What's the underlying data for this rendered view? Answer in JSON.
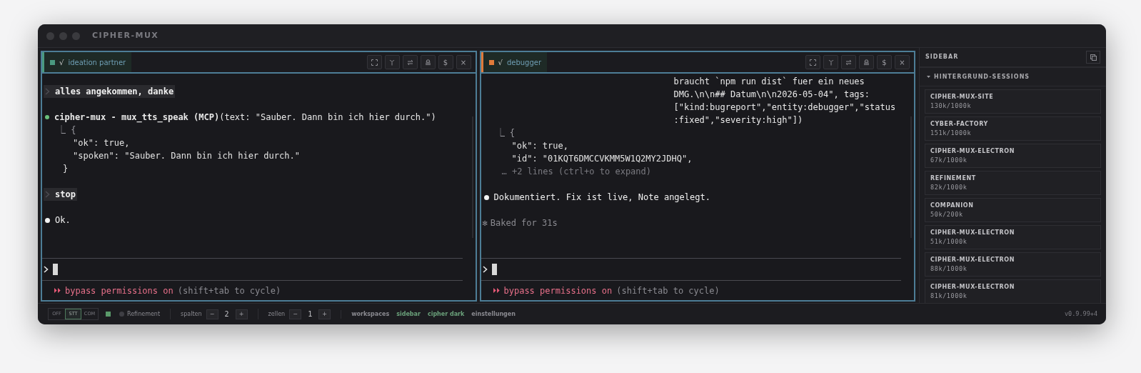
{
  "window": {
    "title": "CIPHER-MUX"
  },
  "panes": [
    {
      "title": "ideation partner",
      "check": "√",
      "color": "#4a9a80",
      "buttons": [
        {
          "kind": "maximize"
        },
        {
          "kind": "pin"
        },
        {
          "kind": "swap"
        },
        {
          "kind": "stack"
        },
        {
          "kind": "text",
          "label": "$"
        },
        {
          "kind": "text",
          "label": "×"
        }
      ],
      "messages": [
        {
          "kind": "user",
          "text": "alles angekommen, danke"
        },
        {
          "kind": "tool",
          "text": "**cipher-mux - mux_tts_speak (MCP)**(text: \"Sauber. Dann bin ich hier durch.\")",
          "output": {
            "head": "⎿ {",
            "lines": [
              "\"ok\": true,",
              "\"spoken\": \"Sauber. Dann bin ich hier durch.\""
            ],
            "tail": "}"
          }
        },
        {
          "kind": "user",
          "text": "stop"
        },
        {
          "kind": "assistant",
          "text": "Ok."
        }
      ],
      "mode": {
        "marker": "⏵⏵",
        "label": "bypass permissions on",
        "hint": "(shift+tab to cycle)"
      }
    },
    {
      "title": "debugger",
      "check": "√",
      "color": "#e07a3a",
      "buttons": [
        {
          "kind": "maximize"
        },
        {
          "kind": "pin"
        },
        {
          "kind": "swap"
        },
        {
          "kind": "stack"
        },
        {
          "kind": "text",
          "label": "$"
        },
        {
          "kind": "text",
          "label": "×"
        }
      ],
      "messages": [
        {
          "kind": "continuation",
          "lines": [
            "braucht `npm run dist` fuer ein neues",
            "DMG.\\n\\n## Datum\\n\\n2026-05-04\", tags:",
            "[\"kind:bugreport\",\"entity:debugger\",\"status",
            ":fixed\",\"severity:high\"])"
          ],
          "output": {
            "head": "⎿ {",
            "lines": [
              "\"ok\": true,",
              "\"id\": \"01KQT6DMCCVKMM5W1Q2MY2JDHQ\","
            ],
            "note": "… +2 lines (ctrl+o to expand)"
          }
        },
        {
          "kind": "assistant",
          "text": "Dokumentiert. Fix ist live, Note angelegt."
        },
        {
          "kind": "status",
          "marker": "✻",
          "text": "Baked for 31s"
        }
      ],
      "mode": {
        "marker": "⏵⏵",
        "label": "bypass permissions on",
        "hint": "(shift+tab to cycle)"
      }
    }
  ],
  "sidebar": {
    "title": "SIDEBAR",
    "section": {
      "title": "HINTERGRUND-SESSIONS",
      "expanded": true,
      "items": [
        {
          "name": "CIPHER-MUX-SITE",
          "usage": "130k/1000k"
        },
        {
          "name": "CYBER-FACTORY",
          "usage": "151k/1000k"
        },
        {
          "name": "CIPHER-MUX-ELECTRON",
          "usage": "67k/1000k"
        },
        {
          "name": "REFINEMENT",
          "usage": "82k/1000k"
        },
        {
          "name": "COMPANION",
          "usage": "50k/200k"
        },
        {
          "name": "CIPHER-MUX-ELECTRON",
          "usage": "51k/1000k"
        },
        {
          "name": "CIPHER-MUX-ELECTRON",
          "usage": "88k/1000k"
        },
        {
          "name": "CIPHER-MUX-ELECTRON",
          "usage": "81k/1000k"
        }
      ]
    }
  },
  "status_bar": {
    "modes": [
      {
        "label": "OFF",
        "selected": false
      },
      {
        "label": "STT",
        "selected": true
      },
      {
        "label": "COM",
        "selected": false
      }
    ],
    "indicator_on": true,
    "profile": "Refinement",
    "steppers": [
      {
        "label": "spalten",
        "minus": "−",
        "value": "2",
        "plus": "+"
      },
      {
        "label": "zellen",
        "minus": "−",
        "value": "1",
        "plus": "+"
      }
    ],
    "links": [
      {
        "label": "workspaces",
        "active": false
      },
      {
        "label": "sidebar",
        "active": true
      },
      {
        "label": "cipher dark",
        "active": true
      },
      {
        "label": "einstellungen",
        "active": false
      }
    ],
    "version": "v0.9.99+4"
  }
}
